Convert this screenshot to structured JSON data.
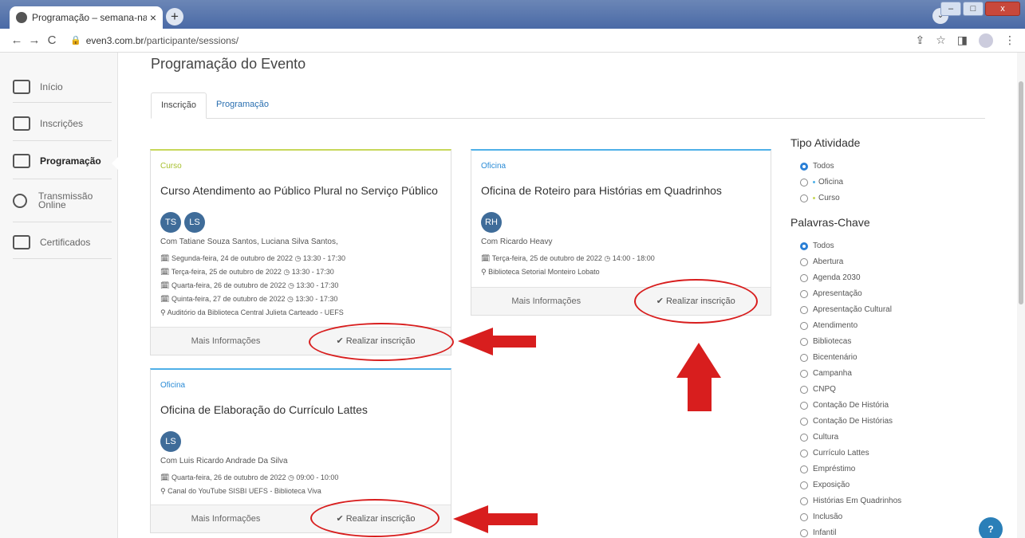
{
  "browser": {
    "tab_title": "Programação – semana-nacional",
    "tab_close": "×",
    "new_tab": "+",
    "back": "←",
    "forward": "→",
    "reload": "C",
    "url_domain": "even3.com.br",
    "url_path": "/participante/sessions/"
  },
  "sidebar": {
    "items": [
      {
        "label": "Início"
      },
      {
        "label": "Inscrições"
      },
      {
        "label": "Programação"
      },
      {
        "label": "Transmissão Online"
      },
      {
        "label": "Certificados"
      }
    ]
  },
  "page": {
    "title": "Programação do Evento",
    "tabs": [
      "Inscrição",
      "Programação"
    ]
  },
  "cards": [
    {
      "type": "Curso",
      "title": "Curso Atendimento ao Público Plural no Serviço Público",
      "avatars": [
        "TS",
        "LS"
      ],
      "speakers": "Com Tatiane Souza Santos, Luciana Silva Santos,",
      "sessions": [
        "Segunda-feira, 24 de outubro de 2022 ◷ 13:30 - 17:30",
        "Terça-feira, 25 de outubro de 2022 ◷ 13:30 - 17:30",
        "Quarta-feira, 26 de outubro de 2022 ◷ 13:30 - 17:30",
        "Quinta-feira, 27 de outubro de 2022 ◷ 13:30 - 17:30"
      ],
      "location": "Auditório da Biblioteca Central Julieta Carteado - UEFS",
      "more": "Mais Informações",
      "signup": "✔ Realizar inscrição"
    },
    {
      "type": "Oficina",
      "title": "Oficina de Roteiro para Histórias em Quadrinhos",
      "avatars": [
        "RH"
      ],
      "speakers": "Com Ricardo Heavy",
      "sessions": [
        "Terça-feira, 25 de outubro de 2022 ◷ 14:00 - 18:00"
      ],
      "location": "Biblioteca Setorial Monteiro Lobato",
      "more": "Mais Informações",
      "signup": "✔ Realizar inscrição"
    },
    {
      "type": "Oficina",
      "title": "Oficina de Elaboração do Currículo Lattes",
      "avatars": [
        "LS"
      ],
      "speakers": "Com Luis Ricardo Andrade Da Silva",
      "sessions": [
        "Quarta-feira, 26 de outubro de 2022 ◷ 09:00 - 10:00"
      ],
      "location": "Canal do YouTube SISBI UEFS - Biblioteca Viva",
      "more": "Mais Informações",
      "signup": "✔ Realizar inscrição"
    }
  ],
  "filters": {
    "tipo_title": "Tipo Atividade",
    "tipo_options": [
      {
        "label": "Todos",
        "selected": true
      },
      {
        "label": "Oficina",
        "selected": false,
        "color": "#4fb0e8"
      },
      {
        "label": "Curso",
        "selected": false,
        "color": "#c7d85a"
      }
    ],
    "palavras_title": "Palavras-Chave",
    "palavras_options": [
      {
        "label": "Todos",
        "selected": true
      },
      {
        "label": "Abertura"
      },
      {
        "label": "Agenda 2030"
      },
      {
        "label": "Apresentação"
      },
      {
        "label": "Apresentação Cultural"
      },
      {
        "label": "Atendimento"
      },
      {
        "label": "Bibliotecas"
      },
      {
        "label": "Bicentenário"
      },
      {
        "label": "Campanha"
      },
      {
        "label": "CNPQ"
      },
      {
        "label": "Contação De História"
      },
      {
        "label": "Contação De Histórias"
      },
      {
        "label": "Cultura"
      },
      {
        "label": "Currículo Lattes"
      },
      {
        "label": "Empréstimo"
      },
      {
        "label": "Exposição"
      },
      {
        "label": "Histórias Em Quadrinhos"
      },
      {
        "label": "Inclusão"
      },
      {
        "label": "Infantil"
      }
    ]
  },
  "annotation_color": "#d81e1e"
}
